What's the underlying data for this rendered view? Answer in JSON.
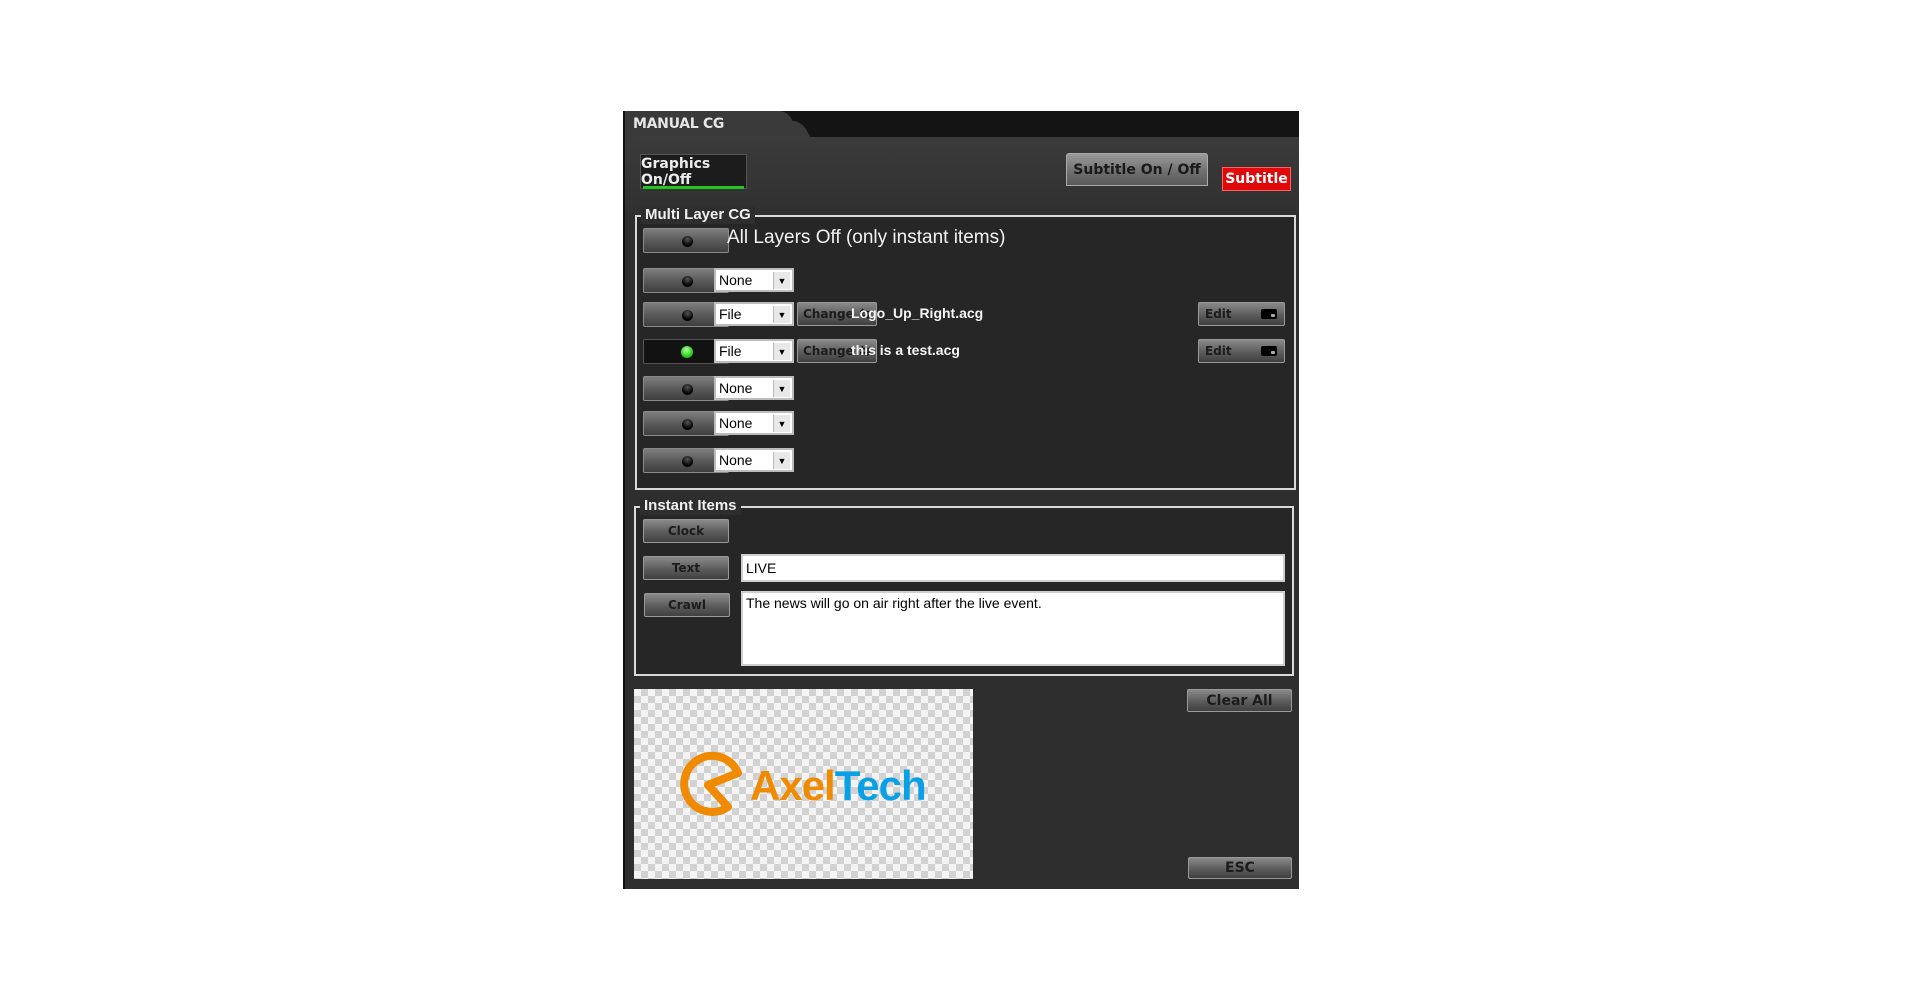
{
  "window": {
    "tab_title": "MANUAL CG"
  },
  "header": {
    "graphics_toggle_label": "Graphics On/Off",
    "subtitle_toggle_label": "Subtitle On / Off",
    "subtitle_badge_label": "Subtitle",
    "accent_green": "#23c41f",
    "badge_red": "#e00808"
  },
  "multi_layer": {
    "title": "Multi Layer CG",
    "all_off_label": "All Layers Off (only instant items)",
    "all_off_active": false,
    "layers": [
      {
        "active": false,
        "source": "None"
      },
      {
        "active": false,
        "source": "File",
        "change_label": "Change",
        "file_name": "Logo_Up_Right.acg",
        "edit_label": "Edit"
      },
      {
        "active": true,
        "source": "File",
        "change_label": "Change",
        "file_name": "this is a test.acg",
        "edit_label": "Edit"
      },
      {
        "active": false,
        "source": "None"
      },
      {
        "active": false,
        "source": "None"
      },
      {
        "active": false,
        "source": "None"
      }
    ]
  },
  "instant_items": {
    "title": "Instant Items",
    "clock_label": "Clock",
    "text_label": "Text",
    "text_value": "LIVE",
    "crawl_label": "Crawl",
    "crawl_value": "The news will go on air right after the live event."
  },
  "preview": {
    "logo_part1": "Axel",
    "logo_part2": "Tech",
    "logo_orange": "#f08a00",
    "logo_blue": "#0aa0e6"
  },
  "footer": {
    "clear_all_label": "Clear All",
    "esc_label": "ESC"
  }
}
